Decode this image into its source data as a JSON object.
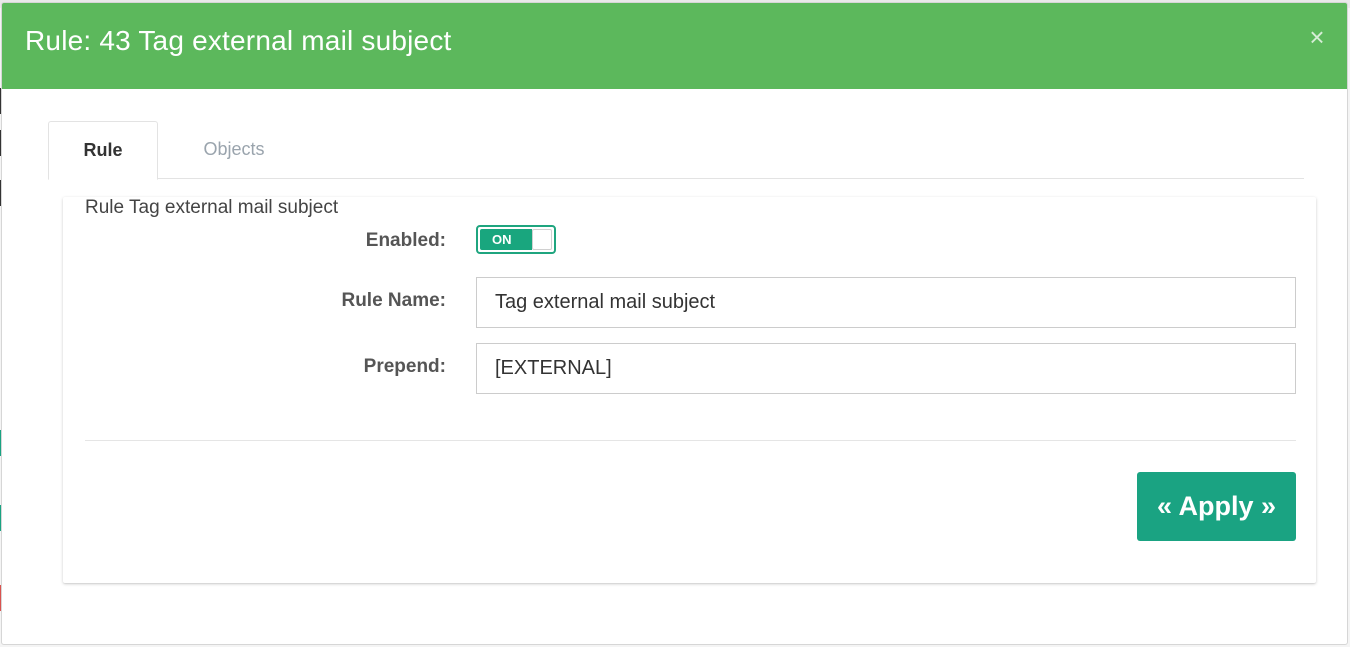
{
  "modal": {
    "title": "Rule: 43 Tag external mail subject",
    "close_symbol": "×"
  },
  "tabs": [
    {
      "label": "Rule",
      "active": true
    },
    {
      "label": "Objects",
      "active": false
    }
  ],
  "panel": {
    "caption": "Rule Tag external mail subject"
  },
  "form": {
    "enabled": {
      "label": "Enabled:",
      "state_text": "ON",
      "checked": true
    },
    "rule_name": {
      "label": "Rule Name:",
      "value": "Tag external mail subject"
    },
    "prepend": {
      "label": "Prepend:",
      "value": "[EXTERNAL]"
    }
  },
  "actions": {
    "apply_label": "« Apply »"
  },
  "colors": {
    "header": "#5cb85c",
    "accent": "#1aa382"
  }
}
